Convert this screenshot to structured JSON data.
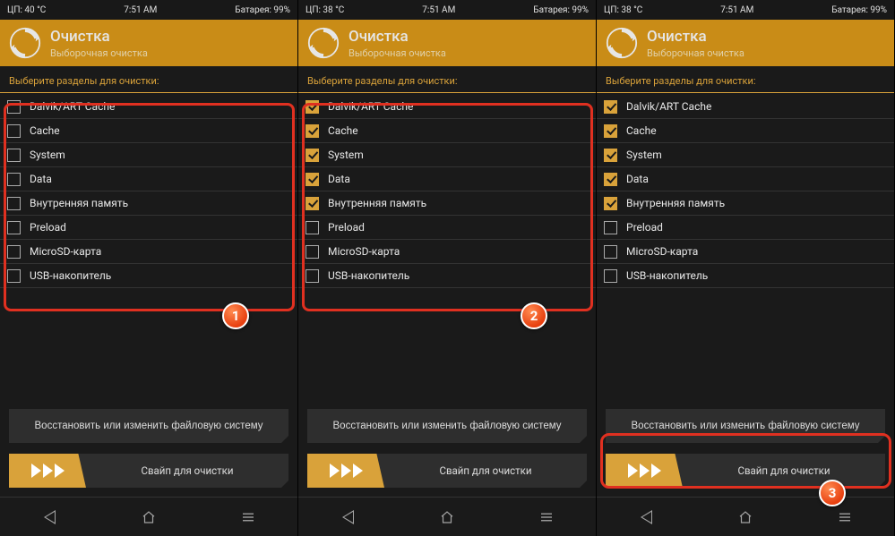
{
  "screens": [
    {
      "status": {
        "cpu": "ЦП: 40 °C",
        "time": "7:51 AM",
        "battery": "Батарея: 99%"
      },
      "title": "Очистка",
      "subtitle": "Выборочная очистка",
      "section_label": "Выберите разделы для очистки:",
      "partitions": [
        {
          "label": "Dalvik/ART Cache",
          "checked": false
        },
        {
          "label": "Cache",
          "checked": false
        },
        {
          "label": "System",
          "checked": false
        },
        {
          "label": "Data",
          "checked": false
        },
        {
          "label": "Внутренняя память",
          "checked": false
        },
        {
          "label": "Preload",
          "checked": false
        },
        {
          "label": "MicroSD-карта",
          "checked": false
        },
        {
          "label": "USB-накопитель",
          "checked": false
        }
      ],
      "repair_btn": "Восстановить или изменить файловую систему",
      "swipe_label": "Свайп для очистки",
      "highlight": "partitions",
      "badge": "1"
    },
    {
      "status": {
        "cpu": "ЦП: 38 °C",
        "time": "7:51 AM",
        "battery": "Батарея: 99%"
      },
      "title": "Очистка",
      "subtitle": "Выборочная очистка",
      "section_label": "Выберите разделы для очистки:",
      "partitions": [
        {
          "label": "Dalvik/ART Cache",
          "checked": true
        },
        {
          "label": "Cache",
          "checked": true
        },
        {
          "label": "System",
          "checked": true
        },
        {
          "label": "Data",
          "checked": true
        },
        {
          "label": "Внутренняя память",
          "checked": true
        },
        {
          "label": "Preload",
          "checked": false
        },
        {
          "label": "MicroSD-карта",
          "checked": false
        },
        {
          "label": "USB-накопитель",
          "checked": false
        }
      ],
      "repair_btn": "Восстановить или изменить файловую систему",
      "swipe_label": "Свайп для очистки",
      "highlight": "partitions",
      "badge": "2"
    },
    {
      "status": {
        "cpu": "ЦП: 38 °C",
        "time": "7:51 AM",
        "battery": "Батарея: 99%"
      },
      "title": "Очистка",
      "subtitle": "Выборочная очистка",
      "section_label": "Выберите разделы для очистки:",
      "partitions": [
        {
          "label": "Dalvik/ART Cache",
          "checked": true
        },
        {
          "label": "Cache",
          "checked": true
        },
        {
          "label": "System",
          "checked": true
        },
        {
          "label": "Data",
          "checked": true
        },
        {
          "label": "Внутренняя память",
          "checked": true
        },
        {
          "label": "Preload",
          "checked": false
        },
        {
          "label": "MicroSD-карта",
          "checked": false
        },
        {
          "label": "USB-накопитель",
          "checked": false
        }
      ],
      "repair_btn": "Восстановить или изменить файловую систему",
      "swipe_label": "Свайп для очистки",
      "highlight": "swipe",
      "badge": "3"
    }
  ]
}
